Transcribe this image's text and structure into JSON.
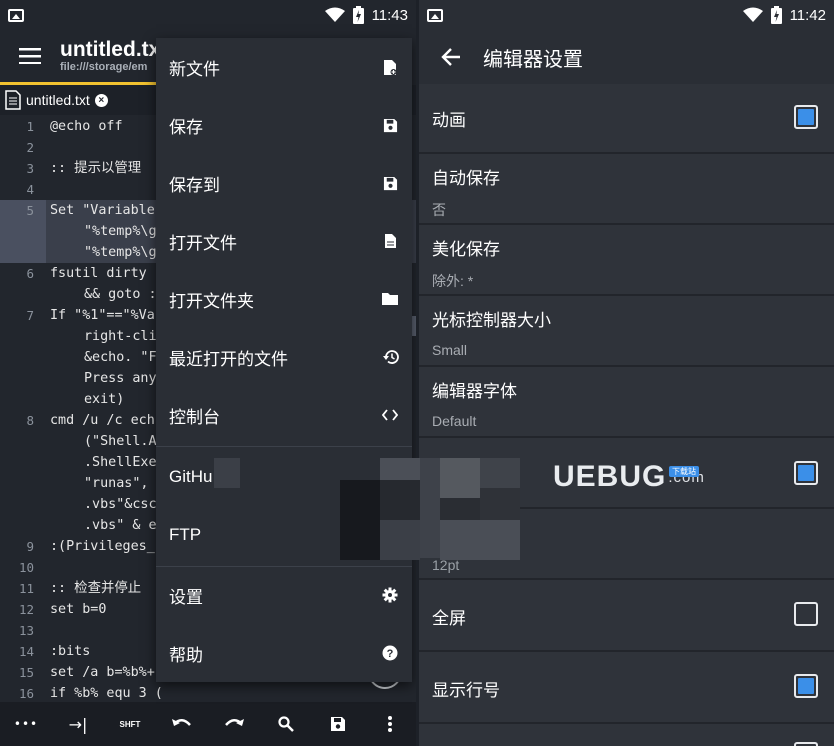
{
  "left": {
    "status": {
      "time": "11:43"
    },
    "appbar": {
      "title": "untitled.txt",
      "path": "file:///storage/em"
    },
    "tab": {
      "label": "untitled.txt"
    },
    "code_lines": [
      {
        "num": "1",
        "text": "@echo off",
        "cont": false
      },
      {
        "num": "2",
        "text": "",
        "cont": false
      },
      {
        "num": "3",
        "text": ":: 提示以管理",
        "cont": false
      },
      {
        "num": "4",
        "text": "",
        "cont": false
      },
      {
        "num": "5",
        "text": "Set \"Variable",
        "cont": false
      },
      {
        "num": "",
        "text": "\"%temp%\\g",
        "cont": true
      },
      {
        "num": "",
        "text": "\"%temp%\\g",
        "cont": true
      },
      {
        "num": "6",
        "text": "fsutil dirty",
        "cont": false
      },
      {
        "num": "",
        "text": "&& goto :",
        "cont": true
      },
      {
        "num": "7",
        "text": "If \"%1\"==\"%Va",
        "cont": false
      },
      {
        "num": "",
        "text": "right-cli",
        "cont": true
      },
      {
        "num": "",
        "text": "&echo. \"F",
        "cont": true
      },
      {
        "num": "",
        "text": "Press any",
        "cont": true
      },
      {
        "num": "",
        "text": "exit)",
        "cont": true
      },
      {
        "num": "8",
        "text": "cmd /u /c ech",
        "cont": false
      },
      {
        "num": "",
        "text": "(\"Shell.A",
        "cont": true
      },
      {
        "num": "",
        "text": ".ShellExe",
        "cont": true
      },
      {
        "num": "",
        "text": "\"runas\",",
        "cont": true
      },
      {
        "num": "",
        "text": ".vbs\"&csc",
        "cont": true
      },
      {
        "num": "",
        "text": ".vbs\" & e",
        "cont": true
      },
      {
        "num": "9",
        "text": ":(Privileges_",
        "cont": false
      },
      {
        "num": "10",
        "text": "",
        "cont": false
      },
      {
        "num": "11",
        "text": ":: 检查并停止",
        "cont": false
      },
      {
        "num": "12",
        "text": "set b=0",
        "cont": false
      },
      {
        "num": "13",
        "text": "",
        "cont": false
      },
      {
        "num": "14",
        "text": ":bits",
        "cont": false
      },
      {
        "num": "15",
        "text": "set /a b=%b%+",
        "cont": false
      },
      {
        "num": "16",
        "text": "if %b% equ 3 (",
        "cont": false
      }
    ],
    "toolbar": {
      "more": "•••",
      "tab_key": "→|",
      "shift_key": "SHFT"
    }
  },
  "menu": {
    "items": [
      {
        "label": "新文件",
        "icon": "new-file-icon"
      },
      {
        "label": "保存",
        "icon": "save-icon"
      },
      {
        "label": "保存到",
        "icon": "save-icon"
      },
      {
        "label": "打开文件",
        "icon": "file-icon"
      },
      {
        "label": "打开文件夹",
        "icon": "folder-icon"
      },
      {
        "label": "最近打开的文件",
        "icon": "history-icon"
      },
      {
        "label": "控制台",
        "icon": "code-icon"
      },
      {
        "label": "GitHu",
        "icon": ""
      },
      {
        "label": "FTP",
        "icon": ""
      },
      {
        "label": "设置",
        "icon": "gear-icon"
      },
      {
        "label": "帮助",
        "icon": "help-icon"
      }
    ]
  },
  "right": {
    "status": {
      "time": "11:42"
    },
    "appbar": {
      "title": "编辑器设置"
    },
    "settings": [
      {
        "title": "动画",
        "sub": "",
        "checkbox": "on"
      },
      {
        "title": "自动保存",
        "sub": "否",
        "checkbox": ""
      },
      {
        "title": "美化保存",
        "sub": "除外: *",
        "checkbox": ""
      },
      {
        "title": "光标控制器大小",
        "sub": "Small",
        "checkbox": ""
      },
      {
        "title": "编辑器字体",
        "sub": "Default",
        "checkbox": ""
      },
      {
        "title": "",
        "sub": "",
        "checkbox": "on"
      },
      {
        "title": "",
        "sub": "12pt",
        "checkbox": ""
      },
      {
        "title": "全屏",
        "sub": "",
        "checkbox": "off"
      },
      {
        "title": "显示行号",
        "sub": "",
        "checkbox": "on"
      }
    ]
  },
  "watermark": {
    "brand": "UEBUG",
    "domain": ".com",
    "badge": "下载站"
  },
  "colors": {
    "accent": "#f2c230",
    "checkbox_on": "#3b8fe8",
    "bg": "#22262d",
    "menu_bg": "#2a2e35"
  }
}
